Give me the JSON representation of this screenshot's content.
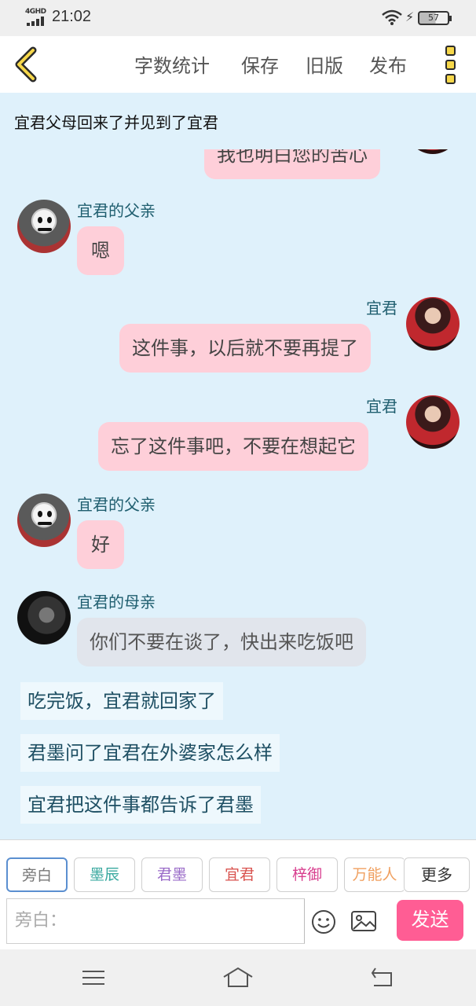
{
  "status_bar": {
    "network": "4GHD",
    "time": "21:02",
    "battery": "57"
  },
  "top_bar": {
    "actions": [
      "字数统计",
      "保存",
      "旧版",
      "发布"
    ]
  },
  "chapter_title": "宜君父母回来了并见到了宜君",
  "messages": [
    {
      "side": "right",
      "text": "我也明白您的苦心"
    },
    {
      "side": "left",
      "name": "宜君的父亲",
      "text": "嗯",
      "style": "pink"
    },
    {
      "side": "right",
      "name": "宜君",
      "text": "这件事，以后就不要再提了",
      "style": "pink"
    },
    {
      "side": "right",
      "name": "宜君",
      "text": "忘了这件事吧，不要在想起它",
      "style": "pink"
    },
    {
      "side": "left",
      "name": "宜君的父亲",
      "text": "好",
      "style": "pink"
    },
    {
      "side": "left",
      "name": "宜君的母亲",
      "text": "你们不要在谈了，快出来吃饭吧",
      "style": "grey"
    }
  ],
  "narrations": [
    "吃完饭，宜君就回家了",
    "君墨问了宜君在外婆家怎么样",
    "宜君把这件事都告诉了君墨"
  ],
  "roles": [
    {
      "label": "旁白",
      "color": "#777777",
      "selected": true
    },
    {
      "label": "墨辰",
      "color": "#3aa9a0"
    },
    {
      "label": "君墨",
      "color": "#9a6bc8"
    },
    {
      "label": "宜君",
      "color": "#d9534f"
    },
    {
      "label": "梓御",
      "color": "#d83f8f"
    },
    {
      "label": "万能人",
      "color": "#f0a060"
    }
  ],
  "more_roles_label": "更多",
  "input": {
    "placeholder": "旁白："
  },
  "send_label": "发送",
  "colors": {
    "chat_bg": "#dff1fb",
    "bubble_pink": "#fecfd9",
    "bubble_grey": "#e1e5ec",
    "send": "#ff5d94",
    "name_text": "#1f5e6f"
  }
}
